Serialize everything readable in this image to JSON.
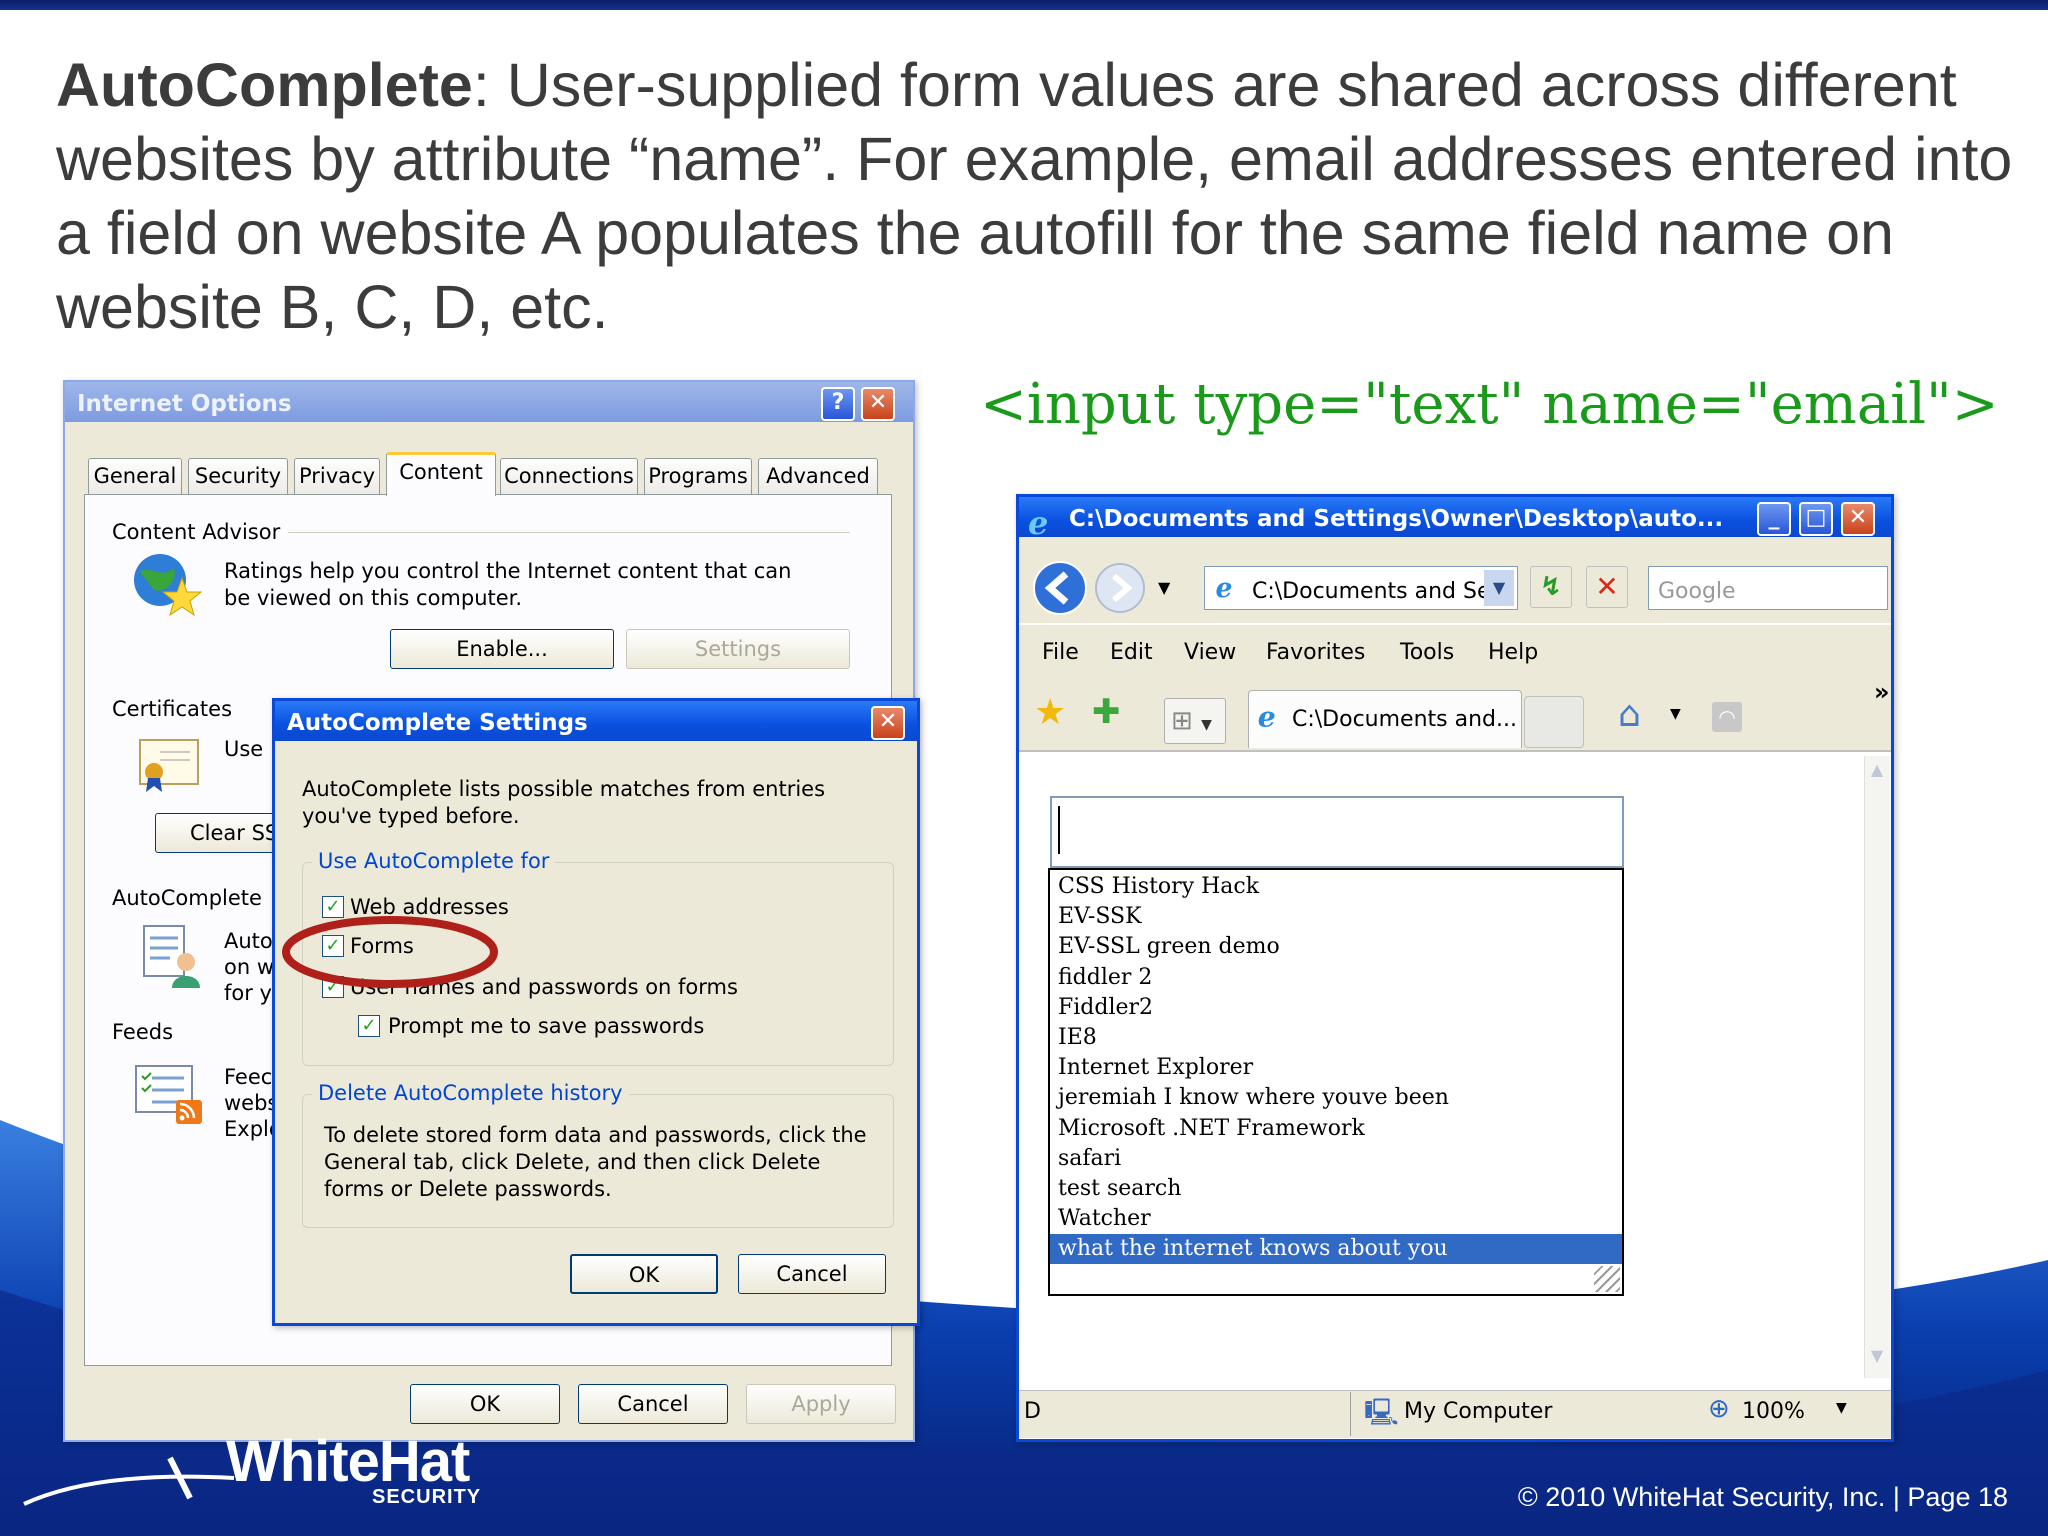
{
  "slide": {
    "heading_bold": "AutoComplete",
    "heading_rest": ": User-supplied form values are shared across different websites by attribute “name”. For example, email addresses entered into a field on website A populates the autofill for the same field name on website B, C, D, etc.",
    "code_snippet": "<input type=\"text\" name=\"email\">",
    "logo_text": "WhiteHat",
    "logo_subtext": "SECURITY",
    "footer": "© 2010 WhiteHat Security, Inc. | Page 18"
  },
  "internet_options": {
    "title": "Internet Options",
    "help_btn": "?",
    "close_btn": "✕",
    "tabs": [
      "General",
      "Security",
      "Privacy",
      "Content",
      "Connections",
      "Programs",
      "Advanced"
    ],
    "active_tab": "Content",
    "content_advisor": {
      "title": "Content Advisor",
      "text": "Ratings help you control the Internet content that can be viewed on this computer.",
      "enable": "Enable...",
      "settings": "Settings"
    },
    "certificates": {
      "title": "Certificates",
      "text": "Use",
      "clear": "Clear SS"
    },
    "autocomplete": {
      "title": "AutoComplete",
      "text1": "Auto",
      "text2": "on w",
      "text3": "for y"
    },
    "feeds": {
      "title": "Feeds",
      "text1": "Feec",
      "text2": "webs",
      "text3": "Explo"
    },
    "ok": "OK",
    "cancel": "Cancel",
    "apply": "Apply"
  },
  "autocomplete_settings": {
    "title": "AutoComplete Settings",
    "close_btn": "✕",
    "intro": "AutoComplete lists possible matches from entries you've typed before.",
    "use_for": "Use AutoComplete for",
    "options": [
      "Web addresses",
      "Forms",
      "User names and passwords on forms",
      "Prompt me to save passwords"
    ],
    "delete_title": "Delete AutoComplete history",
    "delete_text": "To delete stored form data and passwords, click the General tab, click Delete, and then click Delete forms or Delete passwords.",
    "ok": "OK",
    "cancel": "Cancel"
  },
  "browser": {
    "title": "C:\\Documents and Settings\\Owner\\Desktop\\auto...",
    "address": "C:\\Documents and Se",
    "search_placeholder": "Google",
    "menu": [
      "File",
      "Edit",
      "View",
      "Favorites",
      "Tools",
      "Help"
    ],
    "tab_label": "C:\\Documents and...",
    "chevron": "»",
    "autocomplete_list": [
      "CSS History Hack",
      "EV-SSK",
      "EV-SSL green demo",
      "fiddler 2",
      "Fiddler2",
      "IE8",
      "Internet Explorer",
      "jeremiah I know where youve been",
      "Microsoft .NET Framework",
      "safari",
      "test search",
      "Watcher",
      "what the internet knows about you"
    ],
    "selected_item": "what the internet knows about you",
    "status_left": "D",
    "status_zone": "My Computer",
    "zoom": "100%"
  },
  "colors": {
    "highlight": "#316ac5",
    "code_green": "#1a9a1a",
    "xp_title_blue": "#0a58e8",
    "ellipse_red": "#b0201a"
  }
}
